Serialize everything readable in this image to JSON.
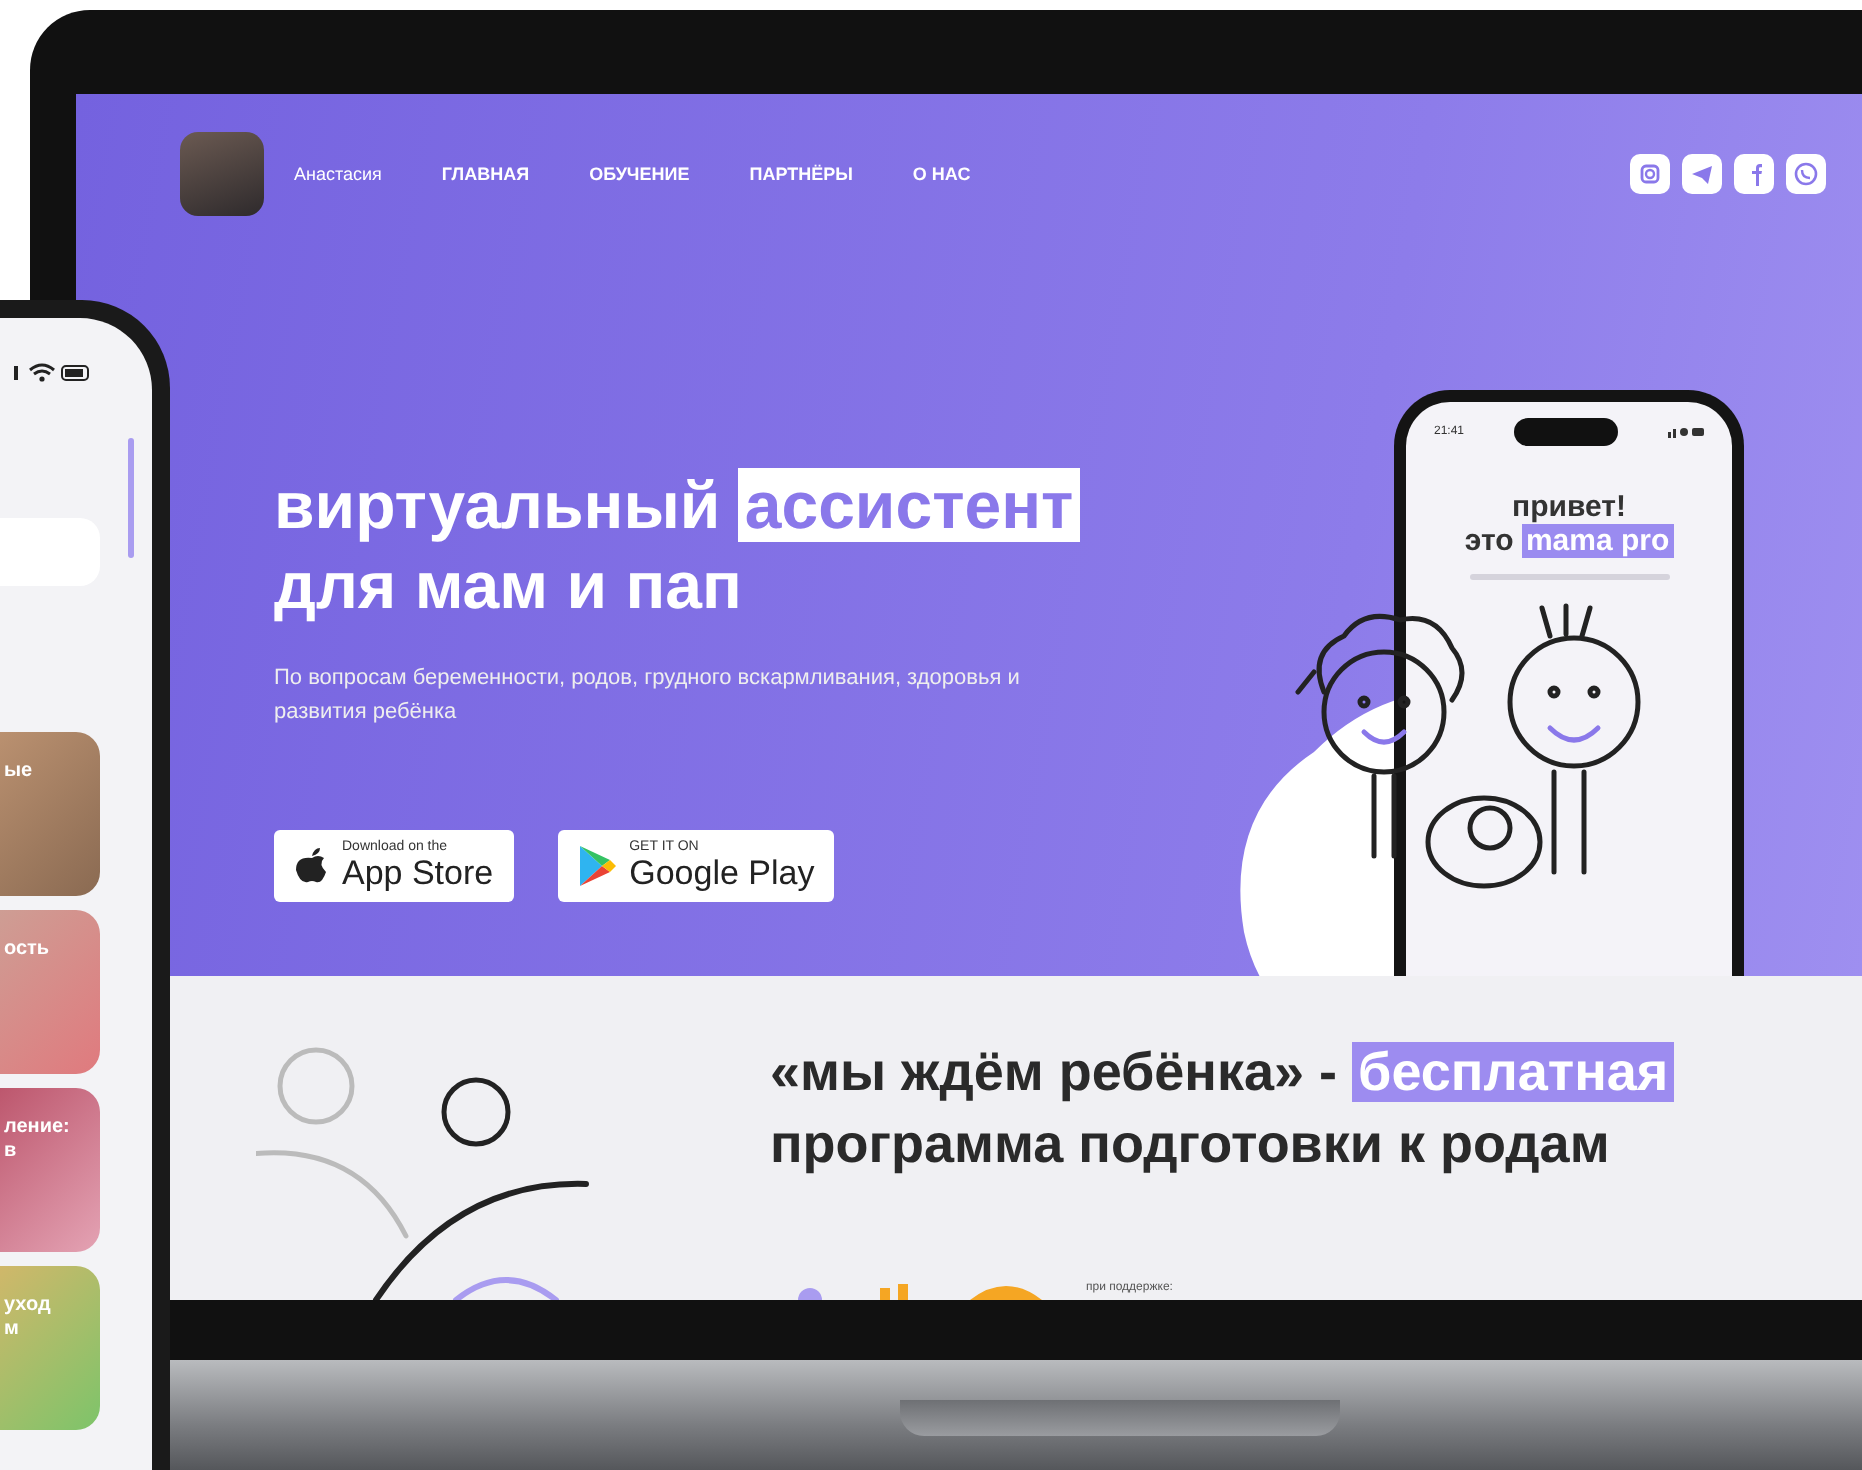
{
  "nav": {
    "user_name": "Анастасия",
    "links": [
      {
        "label": "ГЛАВНАЯ"
      },
      {
        "label": "ОБУЧЕНИЕ"
      },
      {
        "label": "ПАРТНЁРЫ"
      },
      {
        "label": "О НАС"
      }
    ]
  },
  "hero": {
    "heading_lines": [
      [
        {
          "text": "виртуальный",
          "highlighted": false
        },
        {
          "text": "ассистент",
          "highlighted": true
        }
      ],
      [
        {
          "text": "для мам и пап",
          "highlighted": false
        }
      ]
    ],
    "description": "По вопросам беременности, родов, грудного вскармливания, здоровья и развития ребёнка",
    "store_buttons": [
      {
        "kind": "apple",
        "caption": "Download on the",
        "store": "App Store"
      },
      {
        "kind": "google",
        "caption": "GET IT ON",
        "store": "Google Play"
      }
    ],
    "phone": {
      "time": "21:41",
      "greeting_lines": [
        [
          {
            "text": "привет!",
            "highlighted": false
          }
        ],
        [
          {
            "text": "это",
            "highlighted": false
          },
          {
            "text": "mama pro",
            "highlighted": true
          }
        ]
      ]
    }
  },
  "program": {
    "heading_lines": [
      [
        {
          "text": "«мы ждём ребёнка» -",
          "highlighted": false
        },
        {
          "text": "бесплатная",
          "highlighted": true
        }
      ],
      [
        {
          "text": "программа подготовки к родам",
          "highlighted": false
        }
      ]
    ],
    "support_label": "при поддержке:"
  },
  "mobile_phone": {
    "cards": [
      {
        "lines": [
          "ые"
        ]
      },
      {
        "lines": [
          "ость"
        ]
      },
      {
        "lines": [
          "ление:",
          "в"
        ]
      },
      {
        "lines": [
          "уход",
          "м"
        ]
      }
    ]
  }
}
